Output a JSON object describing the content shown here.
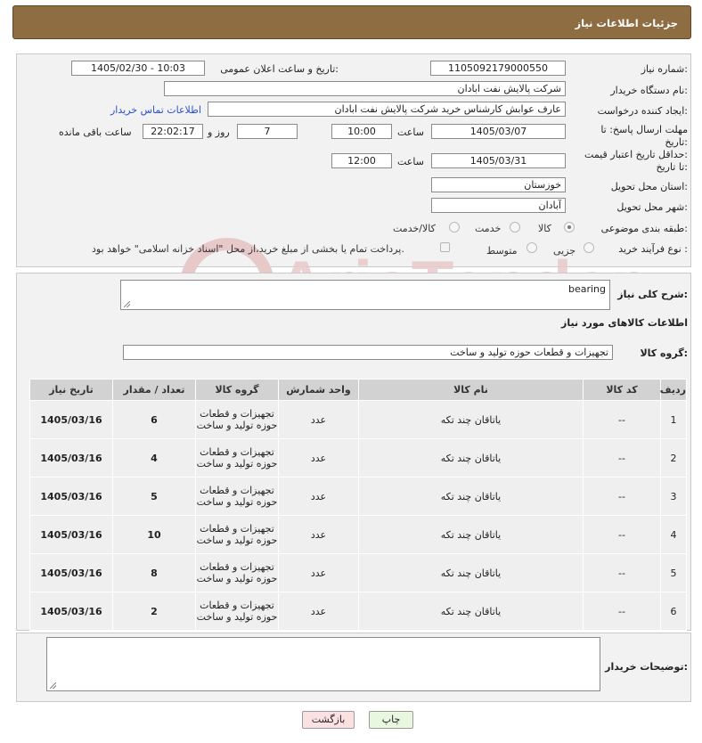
{
  "header": {
    "title": "جزئیات اطلاعات نیاز"
  },
  "labels": {
    "need_number": "شماره نیاز:",
    "announce_datetime": "تاریخ و ساعت اعلان عمومی:",
    "buyer_org": "نام دستگاه خریدار:",
    "requester": "ایجاد کننده درخواست:",
    "contact_link": "اطلاعات تماس خریدار",
    "reply_deadline_1": "مهلت ارسال پاسخ: تا",
    "reply_deadline_2": "تاریخ:",
    "hour": "ساعت",
    "day_and": "روز و",
    "remaining": "ساعت باقی مانده",
    "validity_1": "حداقل تاریخ اعتبار قیمت:",
    "validity_2": "تا تاریخ:",
    "province": "استان محل تحویل:",
    "city": "شهر محل تحویل:",
    "category": "طبقه بندی موضوعی:",
    "process": "نوع فرآیند خرید :",
    "payment_note": "پرداخت تمام یا بخشی از مبلغ خرید،از محل \"اسناد خزانه اسلامی\" خواهد بود.",
    "general_desc": "شرح کلی نیاز:",
    "goods_info": "اطلاعات کالاهای مورد نیاز",
    "goods_group": "گروه کالا:",
    "buyer_notes": "توضیحات خریدار:"
  },
  "fields": {
    "need_number": "1105092179000550",
    "announce_datetime": "1405/02/30 - 10:03",
    "buyer_org": "شرکت پالایش نفت ابادان",
    "requester": "عارف عوابش کارشناس خرید شرکت پالایش نفت ابادان",
    "reply_date": "1405/03/07",
    "reply_time": "10:00",
    "reply_days": "7",
    "reply_remaining": "22:02:17",
    "validity_date": "1405/03/31",
    "validity_time": "12:00",
    "province": "خوزستان",
    "city": "آبادان",
    "general_desc": "bearing",
    "goods_group": "تجهیزات و قطعات حوزه تولید و ساخت"
  },
  "category_options": [
    {
      "label": "کالا",
      "selected": true
    },
    {
      "label": "خدمت",
      "selected": false
    },
    {
      "label": "کالا/خدمت",
      "selected": false
    }
  ],
  "process_options": [
    {
      "label": "جزیی",
      "selected": false
    },
    {
      "label": "متوسط",
      "selected": false
    }
  ],
  "table": {
    "headers": [
      "ردیف",
      "کد کالا",
      "نام کالا",
      "واحد شمارش",
      "گروه کالا",
      "تعداد / مقدار",
      "تاریخ نیاز"
    ],
    "rows": [
      [
        "1",
        "--",
        "یاتاقان چند تکه",
        "عدد",
        "تجهیزات و قطعات حوزه تولید و ساخت",
        "6",
        "1405/03/16"
      ],
      [
        "2",
        "--",
        "یاتاقان چند تکه",
        "عدد",
        "تجهیزات و قطعات حوزه تولید و ساخت",
        "4",
        "1405/03/16"
      ],
      [
        "3",
        "--",
        "یاتاقان چند تکه",
        "عدد",
        "تجهیزات و قطعات حوزه تولید و ساخت",
        "5",
        "1405/03/16"
      ],
      [
        "4",
        "--",
        "یاتاقان چند تکه",
        "عدد",
        "تجهیزات و قطعات حوزه تولید و ساخت",
        "10",
        "1405/03/16"
      ],
      [
        "5",
        "--",
        "یاتاقان چند تکه",
        "عدد",
        "تجهیزات و قطعات حوزه تولید و ساخت",
        "8",
        "1405/03/16"
      ],
      [
        "6",
        "--",
        "یاتاقان چند تکه",
        "عدد",
        "تجهیزات و قطعات حوزه تولید و ساخت",
        "2",
        "1405/03/16"
      ]
    ]
  },
  "buttons": {
    "print": "چاپ",
    "back": "بازگشت"
  },
  "watermark": {
    "text": "AriaTender.net",
    "color": "#e8c9c9"
  },
  "colors": {
    "header_bg": "#8f6d43",
    "link": "#2a4fcf",
    "print_bg": "#e8f7e0",
    "back_bg": "#fbe1e1"
  }
}
